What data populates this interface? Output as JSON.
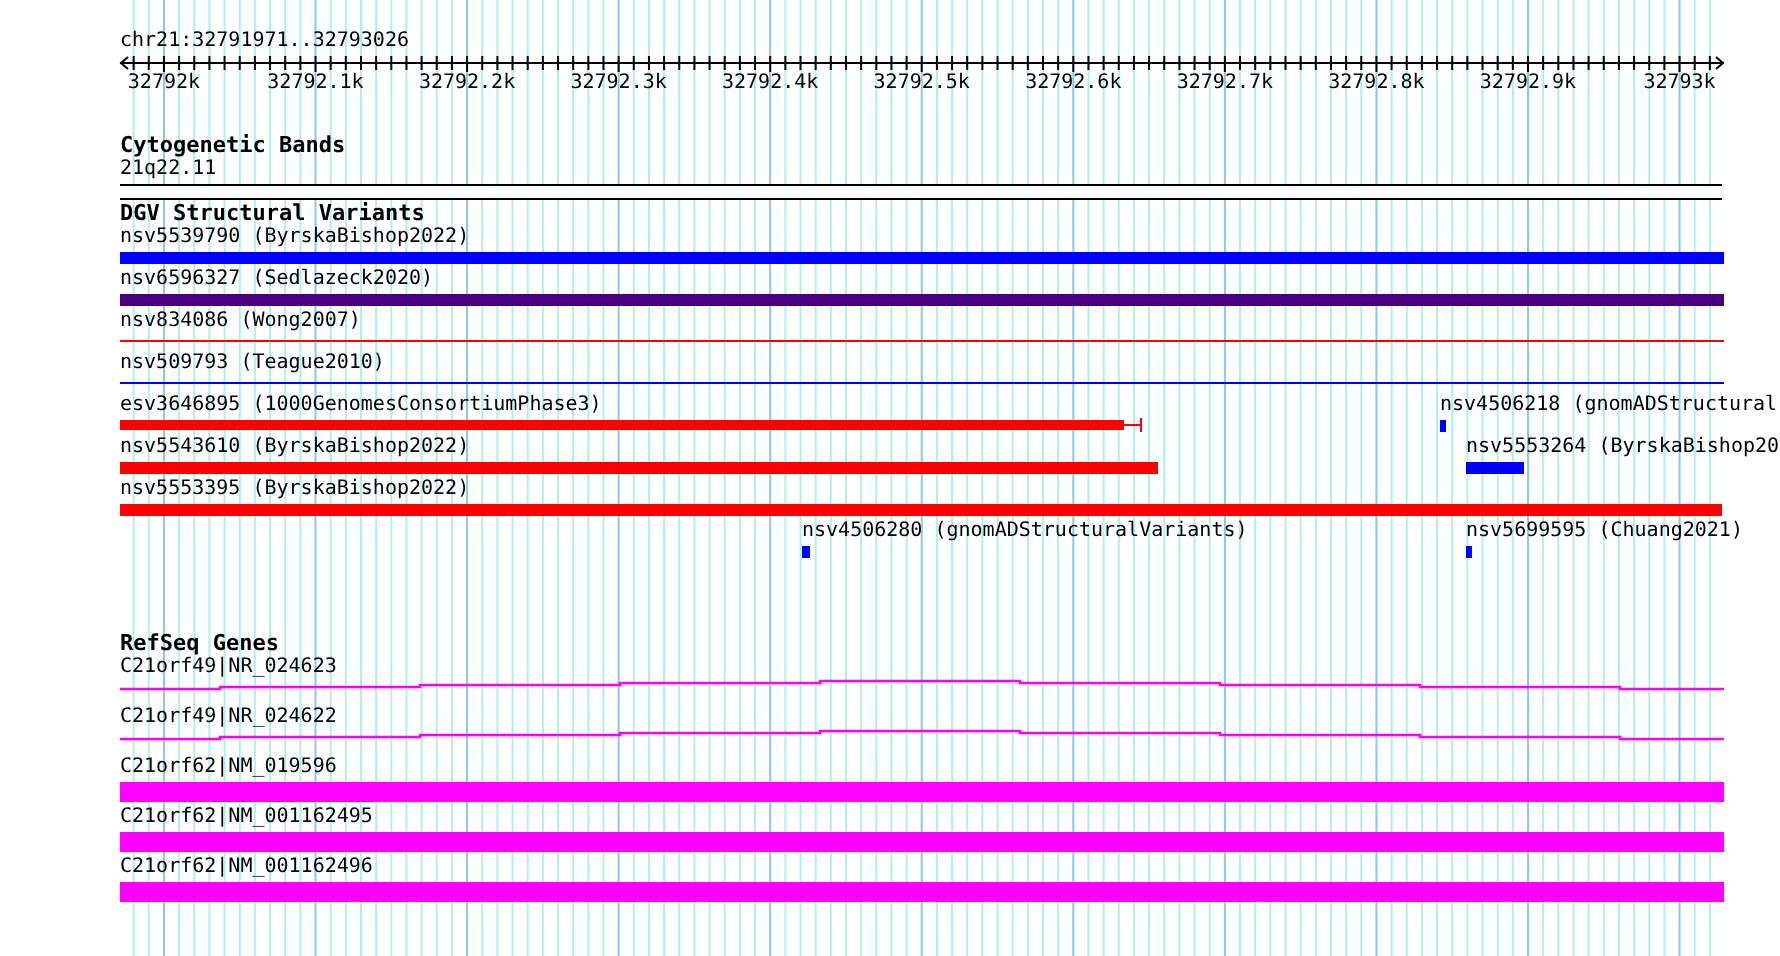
{
  "location": "chr21:32791971..32793026",
  "ruler": {
    "ticks": [
      "32792k",
      "32792.1k",
      "32792.2k",
      "32792.3k",
      "32792.4k",
      "32792.5k",
      "32792.6k",
      "32792.7k",
      "32792.8k",
      "32792.9k",
      "32793k"
    ]
  },
  "cytobands": {
    "title": "Cytogenetic Bands",
    "bands": [
      {
        "label": "21q22.11"
      }
    ]
  },
  "variants": {
    "title": "DGV Structural Variants",
    "rows": [
      [
        {
          "label": "nsv5539790 (ByrskaBishop2022)",
          "color": "#0000ff",
          "kind": "bar"
        }
      ],
      [
        {
          "label": "nsv6596327 (Sedlazeck2020)",
          "color": "#4b0082",
          "kind": "bar"
        }
      ],
      [
        {
          "label": "nsv834086 (Wong2007)",
          "color": "#ff0000",
          "kind": "line"
        }
      ],
      [
        {
          "label": "nsv509793 (Teague2010)",
          "color": "#0000ff",
          "kind": "line"
        }
      ],
      [
        {
          "label": "esv3646895 (1000GenomesConsortiumPhase3)",
          "color": "#ff0000",
          "kind": "bar"
        },
        {
          "label": "nsv4506218 (gnomADStructural",
          "color": "#0000ff",
          "kind": "bar"
        }
      ],
      [
        {
          "label": "nsv5543610 (ByrskaBishop2022)",
          "color": "#ff0000",
          "kind": "bar"
        },
        {
          "label": "nsv5553264 (ByrskaBishop20",
          "color": "#0000ff",
          "kind": "bar"
        }
      ],
      [
        {
          "label": "nsv5553395 (ByrskaBishop2022)",
          "color": "#ff0000",
          "kind": "bar"
        }
      ],
      [
        {
          "label": "nsv4506280 (gnomADStructuralVariants)",
          "color": "#0000ff",
          "kind": "bar"
        },
        {
          "label": "nsv5699595 (Chuang2021)",
          "color": "#0000ff",
          "kind": "bar"
        }
      ]
    ]
  },
  "genes": {
    "title": "RefSeq Genes",
    "rows": [
      {
        "label": "C21orf49|NR_024623",
        "kind": "noncoding"
      },
      {
        "label": "C21orf49|NR_024622",
        "kind": "noncoding"
      },
      {
        "label": "C21orf62|NM_019596",
        "kind": "coding"
      },
      {
        "label": "C21orf62|NM_001162495",
        "kind": "coding"
      },
      {
        "label": "C21orf62|NM_001162496",
        "kind": "coding"
      }
    ]
  }
}
